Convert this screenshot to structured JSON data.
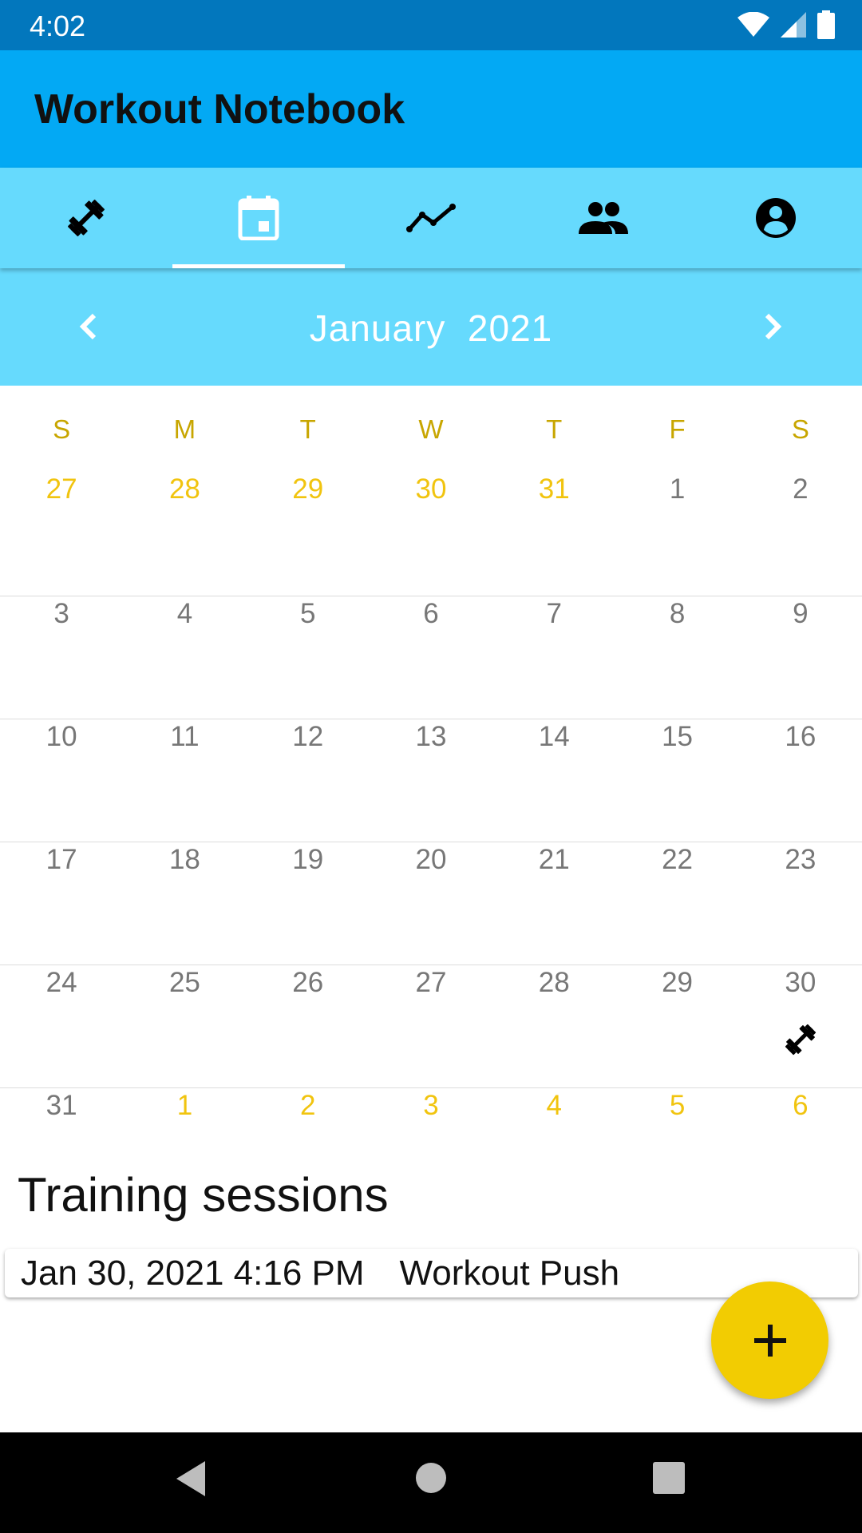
{
  "status_bar": {
    "time": "4:02"
  },
  "app_bar": {
    "title": "Workout Notebook"
  },
  "tabs": [
    {
      "icon": "dumbbell-icon",
      "selected": false
    },
    {
      "icon": "calendar-icon",
      "selected": true
    },
    {
      "icon": "trend-line-icon",
      "selected": false
    },
    {
      "icon": "people-icon",
      "selected": false
    },
    {
      "icon": "account-icon",
      "selected": false
    }
  ],
  "calendar": {
    "month_label": "January  2021",
    "weekdays": [
      "S",
      "M",
      "T",
      "W",
      "T",
      "F",
      "S"
    ],
    "weeks": [
      [
        "27",
        "28",
        "29",
        "30",
        "31",
        "1",
        "2"
      ],
      [
        "3",
        "4",
        "5",
        "6",
        "7",
        "8",
        "9"
      ],
      [
        "10",
        "11",
        "12",
        "13",
        "14",
        "15",
        "16"
      ],
      [
        "17",
        "18",
        "19",
        "20",
        "21",
        "22",
        "23"
      ],
      [
        "24",
        "25",
        "26",
        "27",
        "28",
        "29",
        "30"
      ],
      [
        "31",
        "1",
        "2",
        "3",
        "4",
        "5",
        "6"
      ]
    ],
    "workout_day": "30"
  },
  "sessions": {
    "title": "Training sessions",
    "items": [
      {
        "date": "Jan 30, 2021 4:16 PM",
        "name": "Workout Push"
      }
    ]
  },
  "colors": {
    "primary_dark": "#0277bd",
    "primary": "#03a9f4",
    "primary_light": "#66dafd",
    "accent": "#f2cc02",
    "other_month_day": "#f1c40f"
  }
}
